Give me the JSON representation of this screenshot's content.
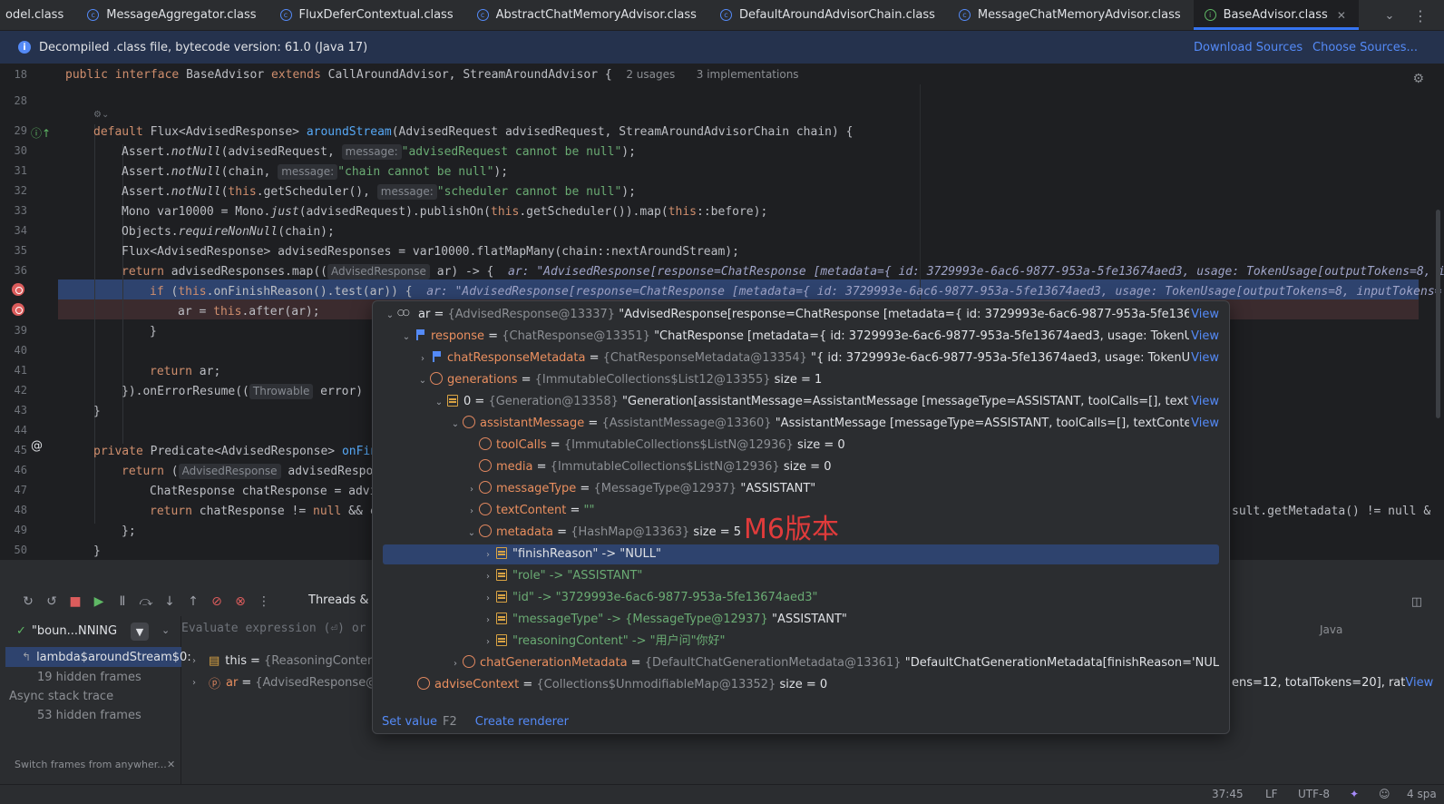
{
  "tabs": [
    {
      "label": "odel.class",
      "icon": "class-icon",
      "active": false
    },
    {
      "label": "MessageAggregator.class",
      "icon": "class-icon",
      "active": false
    },
    {
      "label": "FluxDeferContextual.class",
      "icon": "class-icon",
      "active": false
    },
    {
      "label": "AbstractChatMemoryAdvisor.class",
      "icon": "class-icon",
      "active": false
    },
    {
      "label": "DefaultAroundAdvisorChain.class",
      "icon": "class-icon",
      "active": false
    },
    {
      "label": "MessageChatMemoryAdvisor.class",
      "icon": "class-icon",
      "active": false
    },
    {
      "label": "BaseAdvisor.class",
      "icon": "interface-icon",
      "active": true
    }
  ],
  "banner": {
    "text": "Decompiled .class file, bytecode version: 61.0 (Java 17)",
    "download_sources": "Download Sources",
    "choose_sources": "Choose Sources..."
  },
  "editor": {
    "line_numbers": [
      "18",
      "28",
      "29",
      "30",
      "31",
      "32",
      "33",
      "34",
      "35",
      "36",
      "37",
      "38",
      "39",
      "40",
      "41",
      "42",
      "43",
      "44",
      "45",
      "46",
      "47",
      "48",
      "49",
      "50"
    ],
    "header": {
      "pre": "public ",
      "kw_interface": "interface",
      "name": " BaseAdvisor ",
      "kw_extends": "extends",
      "rest": " CallAroundAdvisor, StreamAroundAdvisor {",
      "usages": "2 usages",
      "implementations": "3 implementations"
    },
    "l29": {
      "kw": "default",
      "a": " Flux<AdvisedResponse> ",
      "fn": "aroundStream",
      "b": "(AdvisedRequest advisedRequest, StreamAroundAdvisorChain chain) {"
    },
    "l30": {
      "a": "Assert.",
      "m": "notNull",
      "b": "(advisedRequest, ",
      "hint": "message:",
      "str": "\"advisedRequest cannot be null\"",
      "c": ");"
    },
    "l31": {
      "a": "Assert.",
      "m": "notNull",
      "b": "(chain, ",
      "hint": "message:",
      "str": "\"chain cannot be null\"",
      "c": ");"
    },
    "l32": {
      "a": "Assert.",
      "m": "notNull",
      "b": "(",
      "kw": "this",
      "b2": ".getScheduler(), ",
      "hint": "message:",
      "str": "\"scheduler cannot be null\"",
      "c": ");"
    },
    "l33": {
      "a": "Mono var10000 = Mono.",
      "m": "just",
      "b": "(advisedRequest).publishOn(",
      "kw": "this",
      "b2": ".getScheduler()).map(",
      "kw2": "this",
      "c": "::before);"
    },
    "l34": {
      "a": "Objects.",
      "m": "requireNonNull",
      "b": "(chain);"
    },
    "l35": {
      "text": "Flux<AdvisedResponse> advisedResponses = var10000.flatMapMany(chain::nextAroundStream);"
    },
    "l36": {
      "kw": "return",
      "a": " advisedResponses.map((",
      "hint": "AdvisedResponse",
      "b": " ar) -> {",
      "inline": "ar: \"AdvisedResponse[response=ChatResponse [metadata={ id: 3729993e-6ac6-9877-953a-5fe13674aed3, usage: TokenUsage[outputTokens=8, i"
    },
    "l37": {
      "kw": "if",
      "a": " (",
      "kw2": "this",
      "b": ".onFinishReason().test(ar)) {",
      "inline": "ar: \"AdvisedResponse[response=ChatResponse [metadata={ id: 3729993e-6ac6-9877-953a-5fe13674aed3, usage: TokenUsage[outputTokens=8, inputTokens="
    },
    "l38": {
      "a": "ar = ",
      "kw": "this",
      "b": ".after(ar);"
    },
    "l39": {
      "text": "}"
    },
    "l41": {
      "kw": "return",
      "b": " ar;"
    },
    "l42": {
      "a": "}).onErrorResume((",
      "hint": "Throwable",
      "b": " error) -"
    },
    "l43": {
      "text": "}"
    },
    "l45": {
      "kw": "private",
      "a": " Predicate<AdvisedResponse> ",
      "fn": "onFin"
    },
    "l46": {
      "kw": "return",
      "a": " (",
      "hint": "AdvisedResponse",
      "b": " advisedRespo"
    },
    "l47": {
      "text": "ChatResponse chatResponse = advi"
    },
    "l48": {
      "kw": "return",
      "a": " chatResponse != ",
      "kw2": "null",
      "b": " && c",
      "tail": "sult.getMetadata() != null &"
    },
    "l49": {
      "text": "};"
    },
    "l50": {
      "text": "}"
    }
  },
  "debugger": {
    "threads_tab": "Threads & Va",
    "thread_name": "\"boun...NNING",
    "frame_selected": "lambda$aroundStream$0:",
    "hidden_frames_1": "19 hidden frames",
    "async_label": "Async stack trace",
    "hidden_frames_2": "53 hidden frames",
    "switch_frames": "Switch frames from anywher...",
    "eval_placeholder": "Evaluate expression (⏎) or",
    "language": "Java",
    "var_this_name": "this",
    "var_this_type": "{ReasoningContentA",
    "var_ar_name": "ar",
    "var_ar_type": "{AdvisedResponse@13",
    "tail_value": "ens=12, totalTokens=20], rat",
    "tail_view": "View"
  },
  "popup": {
    "rows": [
      {
        "name": "ar",
        "type": "{AdvisedResponse@13337}",
        "value": "\"AdvisedResponse[response=ChatResponse [metadata={ id: 3729993e-6ac6-9877-953a-5fe13674aed3, usa...",
        "view": "View"
      },
      {
        "name": "response",
        "type": "{ChatResponse@13351}",
        "value": "\"ChatResponse [metadata={ id: 3729993e-6ac6-9877-953a-5fe13674aed3, usage: TokenUsage[outpu...",
        "view": "View"
      },
      {
        "name": "chatResponseMetadata",
        "type": "{ChatResponseMetadata@13354}",
        "value": "\"{ id: 3729993e-6ac6-9877-953a-5fe13674aed3, usage: TokenUsage[outp...",
        "view": "View"
      },
      {
        "name": "generations",
        "type": "{ImmutableCollections$List12@13355}",
        "value": "size = 1",
        "view": ""
      },
      {
        "name": "0",
        "type": "{Generation@13358}",
        "value": "\"Generation[assistantMessage=AssistantMessage [messageType=ASSISTANT, toolCalls=[], textContent=, m...",
        "view": "View"
      },
      {
        "name": "assistantMessage",
        "type": "{AssistantMessage@13360}",
        "value": "\"AssistantMessage [messageType=ASSISTANT, toolCalls=[], textContent=, metad...",
        "view": "View"
      },
      {
        "name": "toolCalls",
        "type": "{ImmutableCollections$ListN@12936}",
        "value": "size = 0",
        "view": ""
      },
      {
        "name": "media",
        "type": "{ImmutableCollections$ListN@12936}",
        "value": "size = 0",
        "view": ""
      },
      {
        "name": "messageType",
        "type": "{MessageType@12937}",
        "value": "\"ASSISTANT\"",
        "view": ""
      },
      {
        "name": "textContent",
        "type": "",
        "value": "\"\"",
        "view": ""
      },
      {
        "name": "metadata",
        "type": "{HashMap@13363}",
        "value": "size = 5",
        "view": ""
      },
      {
        "name": "\"finishReason\" -> \"NULL\"",
        "type": "",
        "value": "",
        "view": ""
      },
      {
        "name": "\"role\" -> \"ASSISTANT\"",
        "type": "",
        "value": "",
        "view": ""
      },
      {
        "name": "\"id\" -> \"3729993e-6ac6-9877-953a-5fe13674aed3\"",
        "type": "",
        "value": "",
        "view": ""
      },
      {
        "name": "\"messageType\" -> {MessageType@12937}",
        "type": "",
        "value": "\"ASSISTANT\"",
        "view": ""
      },
      {
        "name": "\"reasoningContent\" -> \"用户问\"你好\"",
        "type": "",
        "value": "",
        "view": ""
      },
      {
        "name": "chatGenerationMetadata",
        "type": "{DefaultChatGenerationMetadata@13361}",
        "value": "\"DefaultChatGenerationMetadata[finishReason='NULL', filters=0, me",
        "view": ""
      },
      {
        "name": "adviseContext",
        "type": "{Collections$UnmodifiableMap@13352}",
        "value": "size = 0",
        "view": ""
      }
    ],
    "annotation": "M6版本",
    "set_value": "Set value",
    "set_value_key": "F2",
    "create_renderer": "Create renderer"
  },
  "statusbar": {
    "position": "37:45",
    "line_sep": "LF",
    "encoding": "UTF-8",
    "indent": "4 spa"
  },
  "colors": {
    "accent": "#3574f0",
    "breakpoint": "#db5c5c",
    "selection": "#2e436e",
    "annotation": "#e03b3b"
  }
}
